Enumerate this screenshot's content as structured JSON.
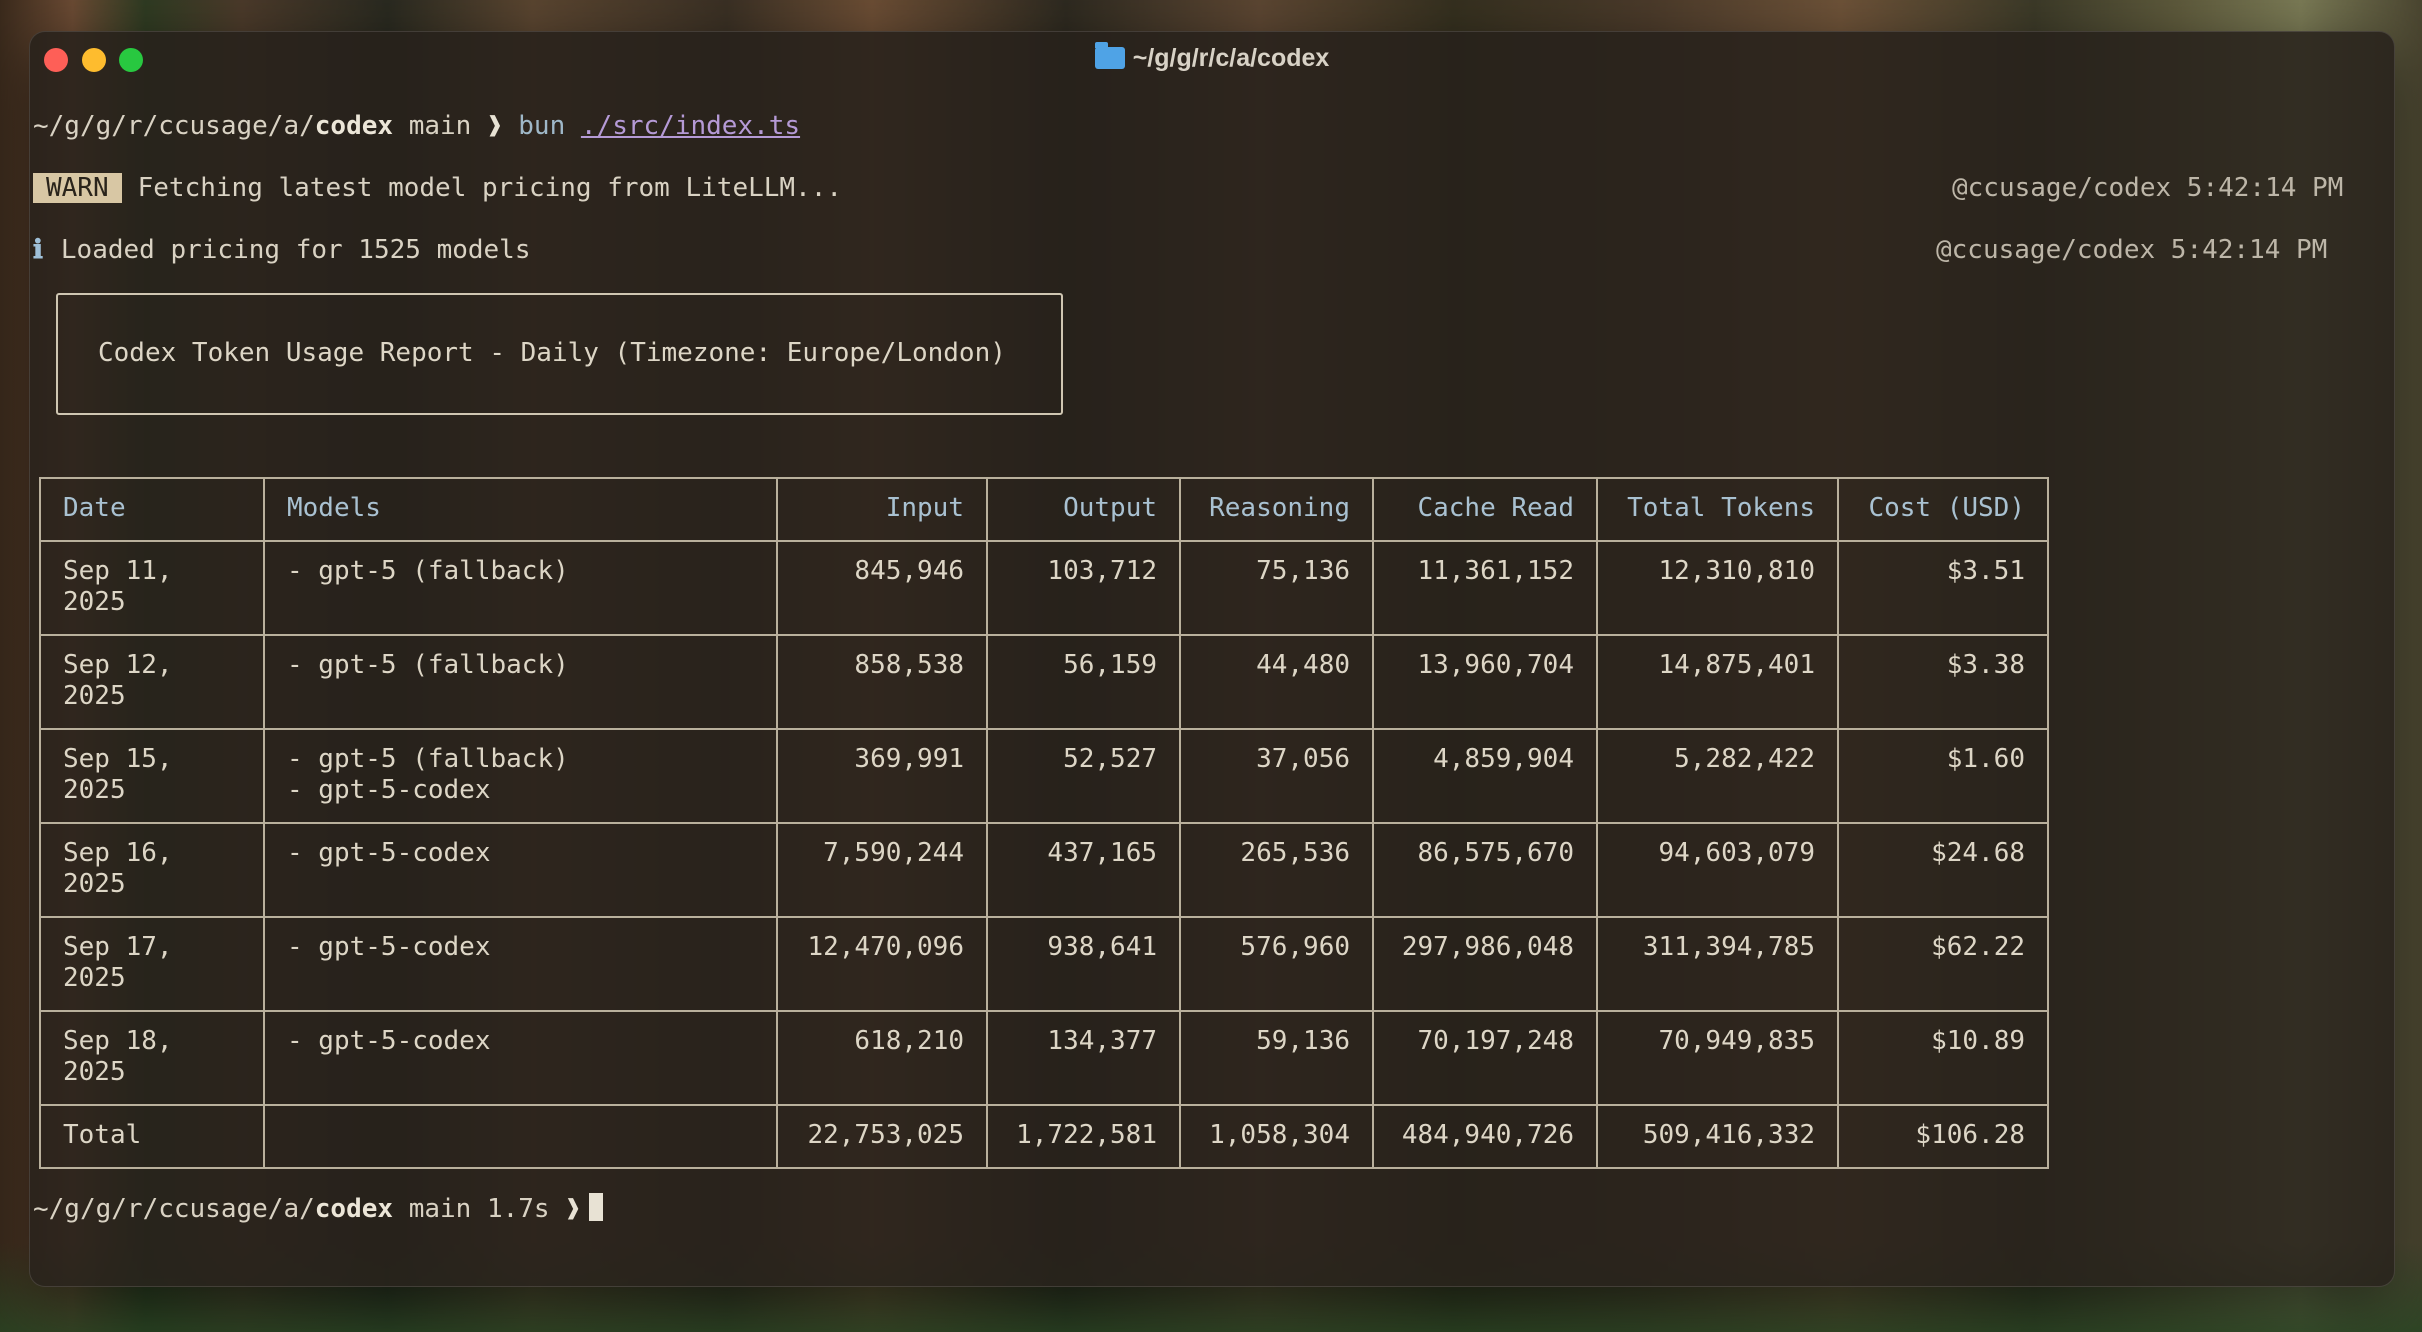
{
  "window": {
    "title": "~/g/g/r/c/a/codex"
  },
  "prompt1": {
    "path_prefix": "~/g/g/r/ccusage/a/",
    "path_dir": "codex",
    "branch": " main ",
    "chevron": "❱",
    "command": " bun ",
    "arg": "./src/index.ts"
  },
  "warn": {
    "badge": "WARN",
    "message": "Fetching latest model pricing from LiteLLM...",
    "meta": "@ccusage/codex 5:42:14 PM"
  },
  "info": {
    "icon": "ℹ",
    "message": "Loaded pricing for 1525 models",
    "meta": "@ccusage/codex 5:42:14 PM"
  },
  "report": {
    "title": "Codex Token Usage Report - Daily (Timezone: Europe/London)"
  },
  "table": {
    "headers": [
      "Date",
      "Models",
      "Input",
      "Output",
      "Reasoning",
      "Cache Read",
      "Total Tokens",
      "Cost (USD)"
    ],
    "rows": [
      {
        "date": "Sep 11,\n2025",
        "models": "- gpt-5 (fallback)",
        "input": "845,946",
        "output": "103,712",
        "reasoning": "75,136",
        "cache_read": "11,361,152",
        "total_tokens": "12,310,810",
        "cost": "$3.51"
      },
      {
        "date": "Sep 12,\n2025",
        "models": "- gpt-5 (fallback)",
        "input": "858,538",
        "output": "56,159",
        "reasoning": "44,480",
        "cache_read": "13,960,704",
        "total_tokens": "14,875,401",
        "cost": "$3.38"
      },
      {
        "date": "Sep 15,\n2025",
        "models": "- gpt-5 (fallback)\n- gpt-5-codex",
        "input": "369,991",
        "output": "52,527",
        "reasoning": "37,056",
        "cache_read": "4,859,904",
        "total_tokens": "5,282,422",
        "cost": "$1.60"
      },
      {
        "date": "Sep 16,\n2025",
        "models": "- gpt-5-codex",
        "input": "7,590,244",
        "output": "437,165",
        "reasoning": "265,536",
        "cache_read": "86,575,670",
        "total_tokens": "94,603,079",
        "cost": "$24.68"
      },
      {
        "date": "Sep 17,\n2025",
        "models": "- gpt-5-codex",
        "input": "12,470,096",
        "output": "938,641",
        "reasoning": "576,960",
        "cache_read": "297,986,048",
        "total_tokens": "311,394,785",
        "cost": "$62.22"
      },
      {
        "date": "Sep 18,\n2025",
        "models": "- gpt-5-codex",
        "input": "618,210",
        "output": "134,377",
        "reasoning": "59,136",
        "cache_read": "70,197,248",
        "total_tokens": "70,949,835",
        "cost": "$10.89"
      }
    ],
    "total": {
      "label": "Total",
      "models": "",
      "input": "22,753,025",
      "output": "1,722,581",
      "reasoning": "1,058,304",
      "cache_read": "484,940,726",
      "total_tokens": "509,416,332",
      "cost": "$106.28"
    }
  },
  "prompt2": {
    "path_prefix": "~/g/g/r/ccusage/a/",
    "path_dir": "codex",
    "branch": " main 1.7s ",
    "chevron": "❱"
  },
  "colors": {
    "window_bg": "#26211b",
    "text": "#ddd6c6",
    "header_text": "#a9c1d1",
    "warn_badge_bg": "#d8c7a4",
    "link": "#b59ad6",
    "close": "#fe5f57",
    "minimize": "#febc2e",
    "maximize": "#28c840",
    "folder": "#4fa3e6"
  },
  "icons": [
    "close-icon",
    "minimize-icon",
    "maximize-icon",
    "folder-icon",
    "info-icon",
    "cursor"
  ]
}
